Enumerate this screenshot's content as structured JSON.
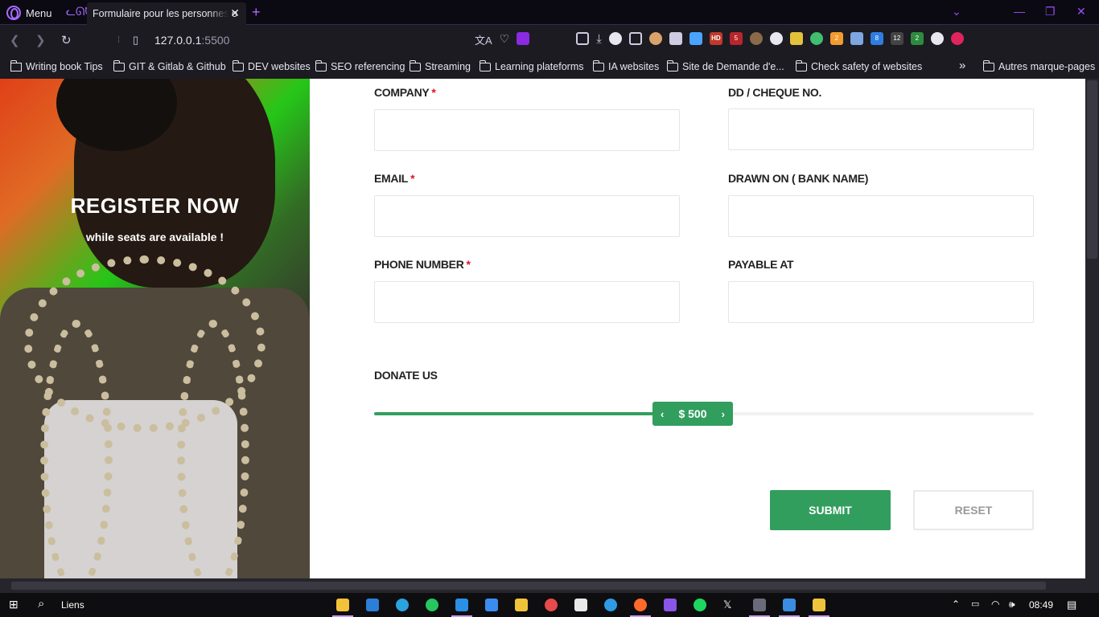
{
  "browser": {
    "menu_label": "Menu",
    "tab_title": "Formulaire pour les personnes o",
    "url_host": "127.0.0.1",
    "url_port": ":5500",
    "ext_badges": [
      "5",
      "HD",
      "2",
      "8",
      "12",
      "2"
    ],
    "bookmarks": [
      "Writing book Tips",
      "GIT & Gitlab & Github",
      "DEV websites",
      "SEO referencing",
      "Streaming",
      "Learning plateforms",
      "IA websites",
      "Site de Demande d'e...",
      "Check safety of websites"
    ],
    "bookmarks_other": "Autres marque-pages"
  },
  "hero": {
    "title": "REGISTER NOW",
    "subtitle": "while seats are available !"
  },
  "form": {
    "fields": [
      {
        "label": "COMPANY",
        "required": true,
        "value": ""
      },
      {
        "label": "DD / CHEQUE NO.",
        "required": false,
        "value": ""
      },
      {
        "label": "EMAIL",
        "required": true,
        "value": ""
      },
      {
        "label": "DRAWN ON ( BANK NAME)",
        "required": false,
        "value": ""
      },
      {
        "label": "PHONE NUMBER",
        "required": true,
        "value": ""
      },
      {
        "label": "PAYABLE AT",
        "required": false,
        "value": ""
      }
    ],
    "required_mark": "*",
    "donate": {
      "label": "DONATE US",
      "value_text": "$ 500",
      "fill_fraction": 0.44
    },
    "submit_label": "SUBMIT",
    "reset_label": "RESET"
  },
  "taskbar": {
    "links_label": "Liens",
    "time": "08:49"
  },
  "colors": {
    "accent_green": "#329e5e",
    "required_red": "#e0141e",
    "browser_purple": "#a86bff"
  }
}
